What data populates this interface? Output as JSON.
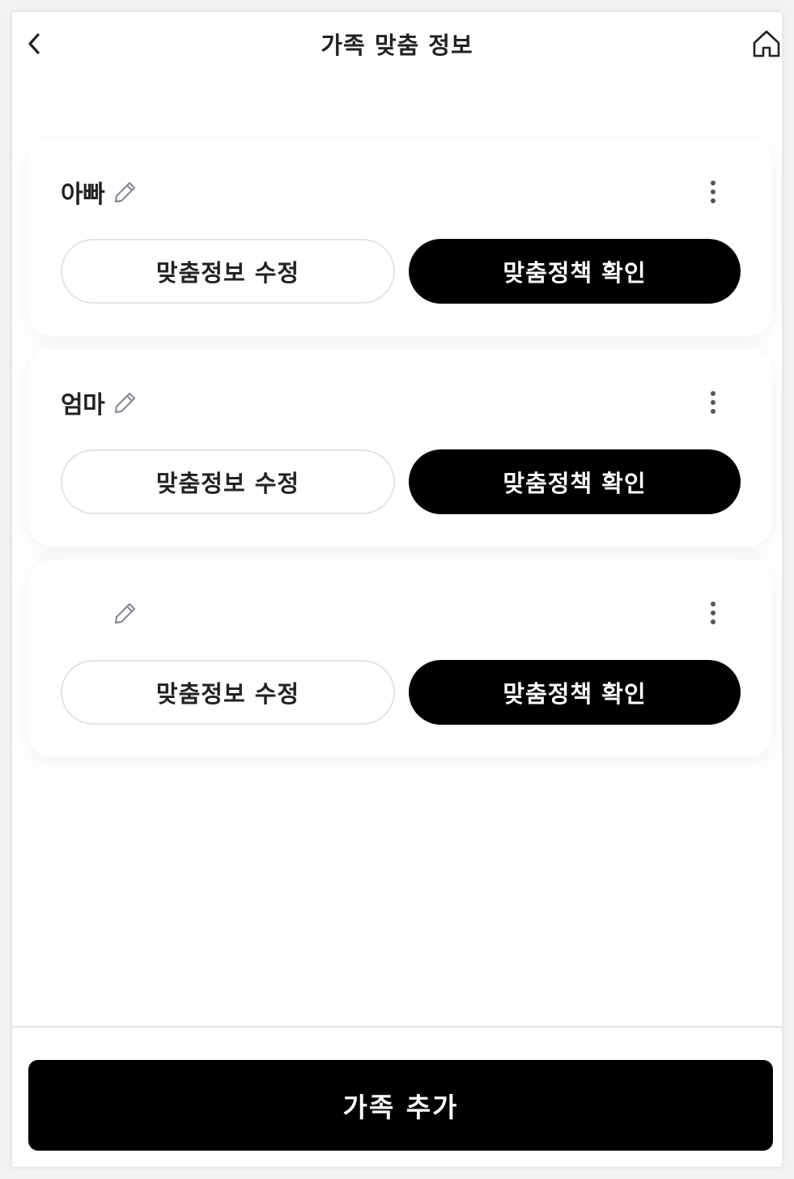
{
  "header": {
    "title": "가족 맞춤 정보",
    "back_icon": "chevron-left-icon",
    "home_icon": "home-icon"
  },
  "members": [
    {
      "name": "아빠",
      "edit_info_label": "맞춤정보 수정",
      "check_policy_label": "맞춤정책 확인"
    },
    {
      "name": "엄마",
      "edit_info_label": "맞춤정보 수정",
      "check_policy_label": "맞춤정책 확인"
    },
    {
      "name": "",
      "edit_info_label": "맞춤정보 수정",
      "check_policy_label": "맞춤정책 확인"
    }
  ],
  "footer": {
    "add_family_label": "가족 추가"
  },
  "colors": {
    "primary": "#000000",
    "background": "#ffffff",
    "text": "#222222",
    "border": "#e3e3e6",
    "icon_muted": "#8a8a96"
  }
}
